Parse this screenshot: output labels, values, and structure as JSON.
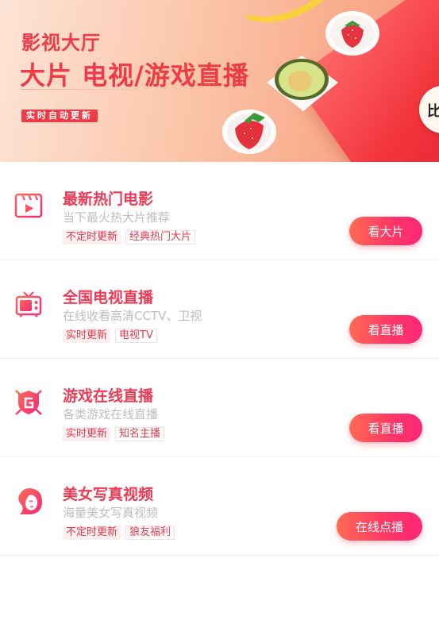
{
  "banner": {
    "title": "影视大厅",
    "headline": "大片 电视/游戏直播",
    "badge": "实时自动更新",
    "corner_text": "比"
  },
  "colors": {
    "accent": "#ee3a55",
    "button_gradient_start": "#ff6a54",
    "button_gradient_end": "#fb2778",
    "tag_bg": "#fdeef0",
    "desc": "#bdbdbd"
  },
  "items": [
    {
      "icon": "film-play-icon",
      "title": "最新热门电影",
      "desc": "当下最火热大片推荐",
      "tags": [
        "不定时更新",
        "经典热门大片"
      ],
      "button": "看大片"
    },
    {
      "icon": "tv-icon",
      "title": "全国电视直播",
      "desc": "在线收看高清CCTV、卫视",
      "tags": [
        "实时更新",
        "电视TV"
      ],
      "button": "看直播"
    },
    {
      "icon": "game-shield-icon",
      "title": "游戏在线直播",
      "desc": "各类游戏在线直播",
      "tags": [
        "实时更新",
        "知名主播"
      ],
      "button": "看直播"
    },
    {
      "icon": "woman-face-icon",
      "title": "美女写真视频",
      "desc": "海量美女写真视频",
      "tags": [
        "不定时更新",
        "狼友福利"
      ],
      "button": "在线点播"
    }
  ]
}
